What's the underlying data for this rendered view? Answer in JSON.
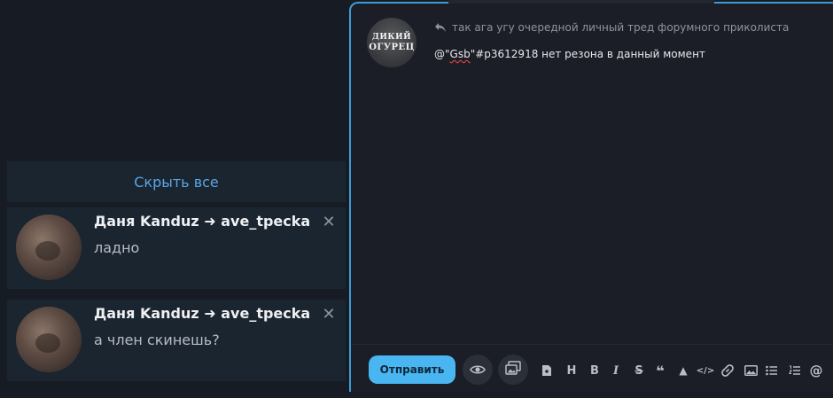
{
  "notifications": {
    "hide_all_label": "Скрыть все",
    "items": [
      {
        "title": "Даня Kanduz ➜ ave_tpecka",
        "text": "ладно"
      },
      {
        "title": "Даня Kanduz ➜ ave_tpecka",
        "text": "а член скинешь?"
      }
    ],
    "close_glyph": "✕"
  },
  "editor": {
    "logo": {
      "line1": "ДИКИЙ",
      "line2": "ОГУРЕЦ"
    },
    "quote_text": "так ага угу очередной личный тред форумного приколиста",
    "message": {
      "prefix": "@\"",
      "mention": "Gsb",
      "suffix": "\"#p3612918 нет резона в данный момент"
    },
    "send_label": "Отправить",
    "toolbar_icons": {
      "heading": "H",
      "bold": "B",
      "italic": "I",
      "strike": "S",
      "quote": "❝",
      "warning": "▲",
      "code": "</>",
      "mention": "@"
    }
  },
  "colors": {
    "accent": "#49b6f2",
    "link": "#58a6e6",
    "panel": "#1b2530",
    "background": "#171b24"
  }
}
